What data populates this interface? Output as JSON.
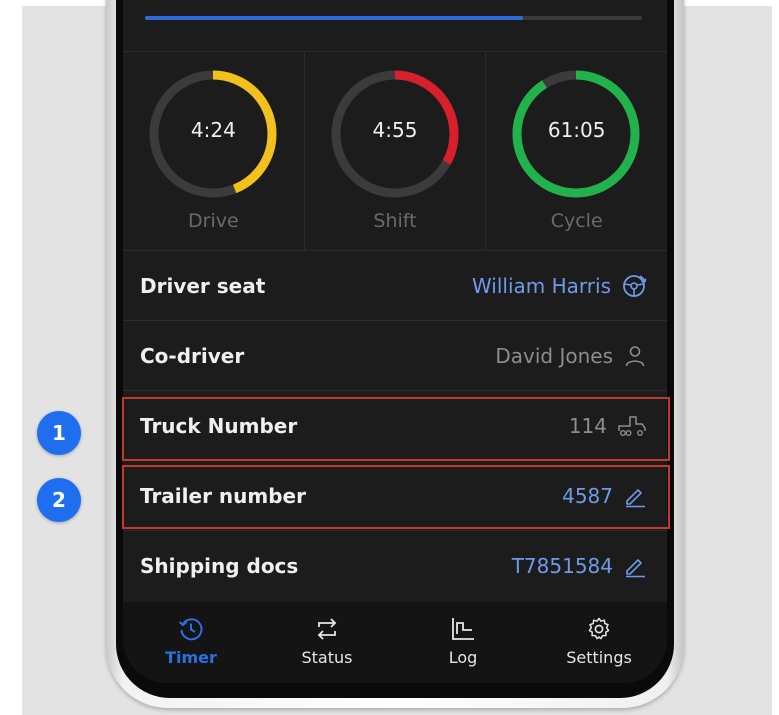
{
  "progress": {
    "fraction": 0.76,
    "color": "#2e6ad9"
  },
  "timers": [
    {
      "value": "4:24",
      "label": "Drive",
      "color": "#f2c11b",
      "fraction": 0.44
    },
    {
      "value": "4:55",
      "label": "Shift",
      "color": "#d8202c",
      "fraction": 0.33
    },
    {
      "value": "61:05",
      "label": "Cycle",
      "color": "#22b24c",
      "fraction": 0.91
    }
  ],
  "rows": [
    {
      "label": "Driver seat",
      "value": "William Harris",
      "icon": "steering-wheel-icon"
    },
    {
      "label": "Co-driver",
      "value": "David Jones",
      "icon": "person-icon"
    },
    {
      "label": "Truck Number",
      "value": "114",
      "icon": "truck-icon"
    },
    {
      "label": "Trailer number",
      "value": "4587",
      "icon": "pencil-icon"
    },
    {
      "label": "Shipping docs",
      "value": "T7851584",
      "icon": "pencil-icon"
    }
  ],
  "tabs": [
    {
      "label": "Timer",
      "icon": "history-clock-icon",
      "active": true
    },
    {
      "label": "Status",
      "icon": "swap-arrows-icon",
      "active": false
    },
    {
      "label": "Log",
      "icon": "step-chart-icon",
      "active": false
    },
    {
      "label": "Settings",
      "icon": "gear-icon",
      "active": false
    }
  ],
  "badges": [
    "1",
    "2"
  ],
  "colors": {
    "accent": "#2b6fe0",
    "link": "#6f9ae8",
    "highlight": "#c0392b",
    "badge": "#1f6ef0"
  }
}
